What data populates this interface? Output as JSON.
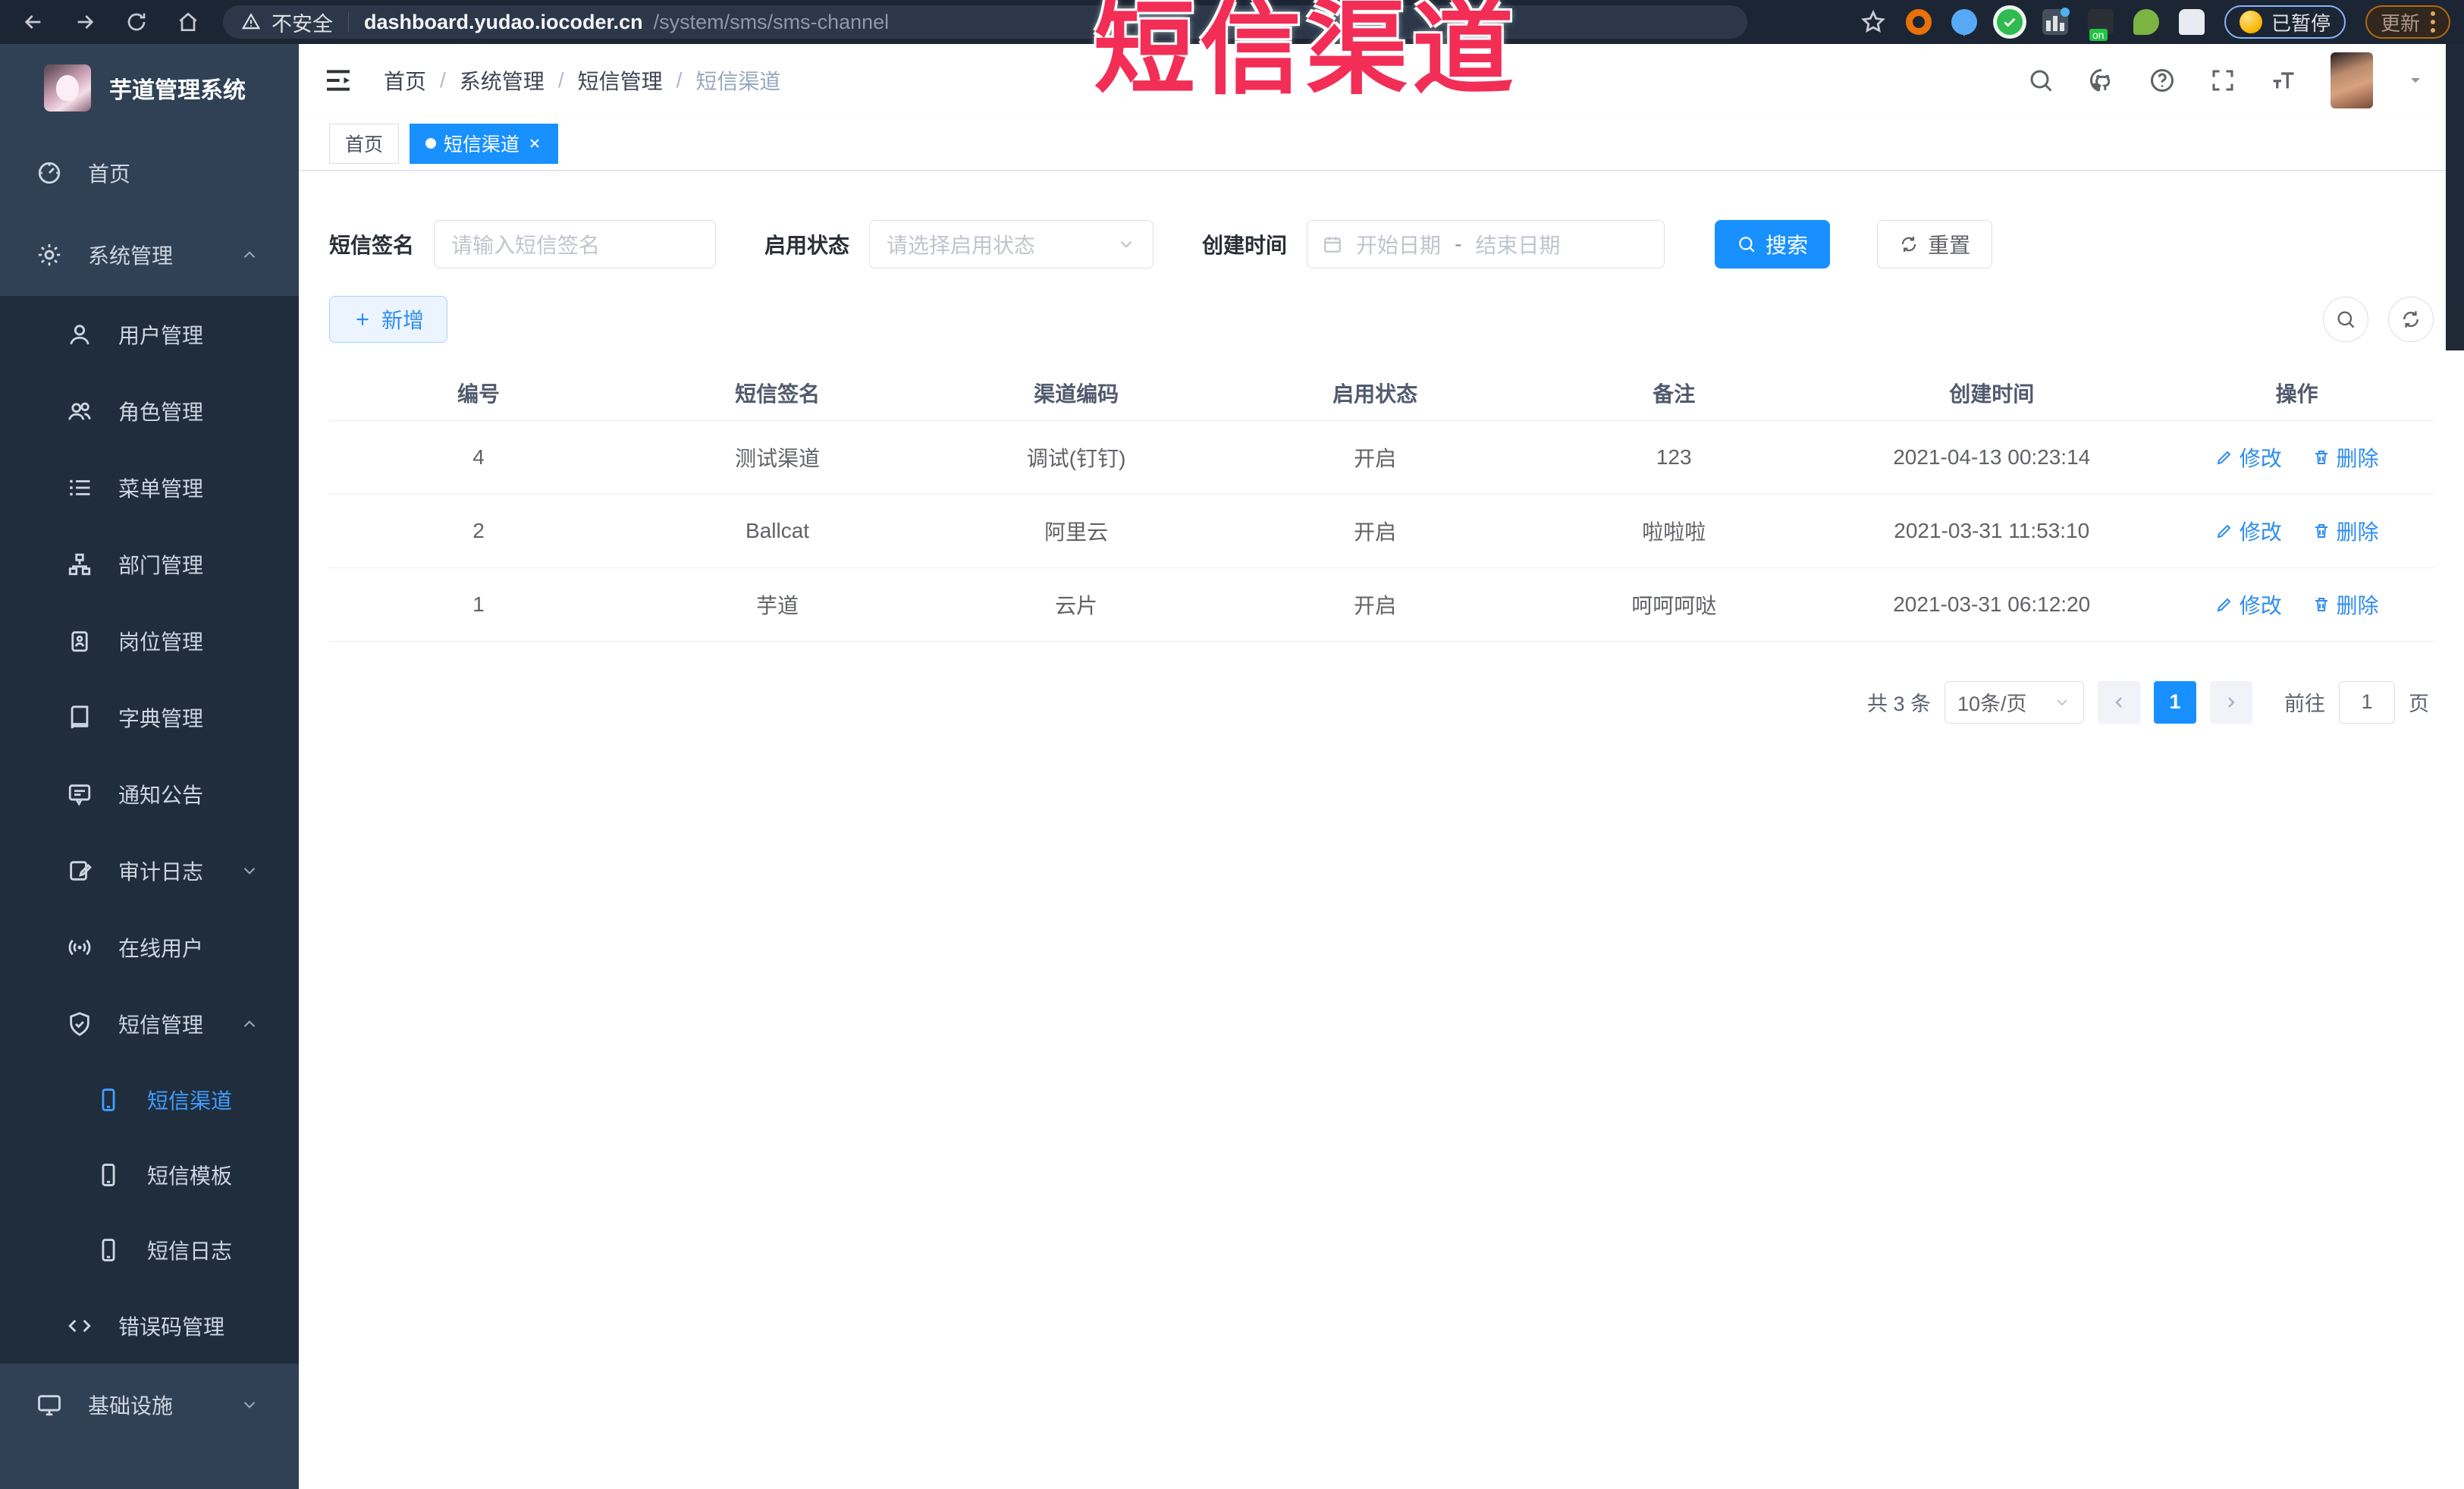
{
  "browser": {
    "security_label": "不安全",
    "url_domain": "dashboard.yudao.iocoder.cn",
    "url_path": "/system/sms/sms-channel",
    "paused_badge": "已暂停",
    "update_button": "更新"
  },
  "watermark": "短信渠道",
  "sidebar": {
    "title": "芋道管理系统",
    "items": [
      {
        "label": "首页"
      },
      {
        "label": "系统管理"
      },
      {
        "label": "用户管理"
      },
      {
        "label": "角色管理"
      },
      {
        "label": "菜单管理"
      },
      {
        "label": "部门管理"
      },
      {
        "label": "岗位管理"
      },
      {
        "label": "字典管理"
      },
      {
        "label": "通知公告"
      },
      {
        "label": "审计日志"
      },
      {
        "label": "在线用户"
      },
      {
        "label": "短信管理"
      },
      {
        "label": "短信渠道"
      },
      {
        "label": "短信模板"
      },
      {
        "label": "短信日志"
      },
      {
        "label": "错误码管理"
      },
      {
        "label": "基础设施"
      }
    ]
  },
  "header": {
    "breadcrumb": [
      "首页",
      "系统管理",
      "短信管理",
      "短信渠道"
    ],
    "separator": "/"
  },
  "tabs": [
    {
      "label": "首页"
    },
    {
      "label": "短信渠道"
    }
  ],
  "filters": {
    "sign_label": "短信签名",
    "sign_placeholder": "请输入短信签名",
    "status_label": "启用状态",
    "status_placeholder": "请选择启用状态",
    "date_label": "创建时间",
    "date_start_placeholder": "开始日期",
    "date_separator": "-",
    "date_end_placeholder": "结束日期",
    "search_button": "搜索",
    "reset_button": "重置"
  },
  "toolbar": {
    "add_button": "新增"
  },
  "table": {
    "headers": [
      "编号",
      "短信签名",
      "渠道编码",
      "启用状态",
      "备注",
      "创建时间",
      "操作"
    ],
    "edit_label": "修改",
    "delete_label": "删除",
    "rows": [
      {
        "id": "4",
        "sign": "测试渠道",
        "code": "调试(钉钉)",
        "status": "开启",
        "remark": "123",
        "created": "2021-04-13 00:23:14"
      },
      {
        "id": "2",
        "sign": "Ballcat",
        "code": "阿里云",
        "status": "开启",
        "remark": "啦啦啦",
        "created": "2021-03-31 11:53:10"
      },
      {
        "id": "1",
        "sign": "芋道",
        "code": "云片",
        "status": "开启",
        "remark": "呵呵呵哒",
        "created": "2021-03-31 06:12:20"
      }
    ]
  },
  "pagination": {
    "total": "共 3 条",
    "page_size": "10条/页",
    "current_page": "1",
    "goto_label": "前往",
    "goto_value": "1",
    "page_unit": "页"
  },
  "colors": {
    "accent": "#1890ff",
    "sidebar_bg": "#304156",
    "submenu_bg": "#1f2d3d",
    "watermark": "#f22e56"
  }
}
